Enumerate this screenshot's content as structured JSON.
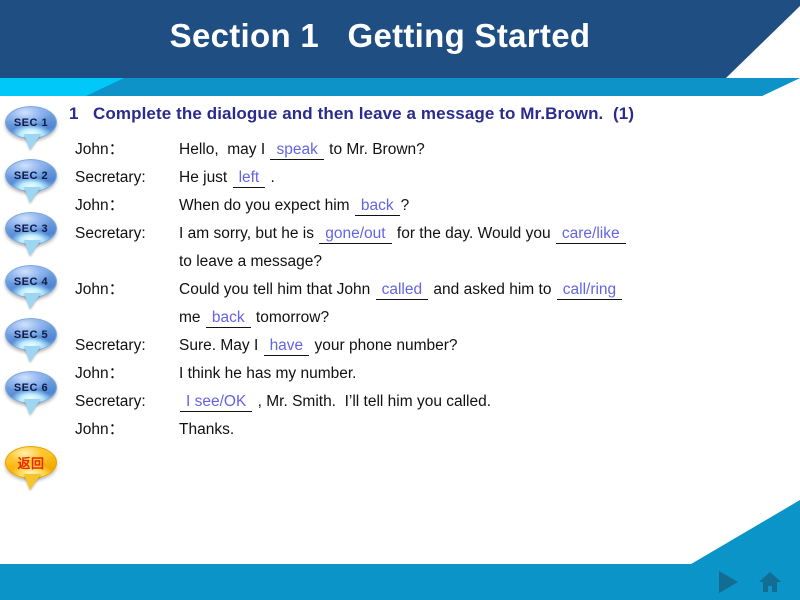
{
  "header": {
    "title": "Section 1   Getting Started",
    "band_color": "#1F4E83",
    "stripe_cyan": "#00C9FA",
    "stripe_blue": "#0D93C7"
  },
  "sidebar": {
    "items": [
      {
        "label": "SEC 1",
        "icon": "speech-bubble-icon"
      },
      {
        "label": "SEC 2",
        "icon": "speech-bubble-icon"
      },
      {
        "label": "SEC 3",
        "icon": "speech-bubble-icon"
      },
      {
        "label": "SEC 4",
        "icon": "speech-bubble-icon"
      },
      {
        "label": "SEC 5",
        "icon": "speech-bubble-icon"
      },
      {
        "label": "SEC 6",
        "icon": "speech-bubble-icon"
      }
    ],
    "back_button": {
      "label": "返回",
      "icon": "speech-bubble-icon",
      "color": "#F9BB18",
      "text_color": "#E8290B"
    }
  },
  "main": {
    "exercise_title": "1   Complete the dialogue and then leave a message to Mr.Brown.  (1)",
    "title_color": "#2B2B8F",
    "blank_color": "#6464E6",
    "dialogue": [
      {
        "speaker": "John：",
        "parts": [
          {
            "type": "text",
            "value": "Hello,  may I "
          },
          {
            "type": "blank",
            "value": "speak"
          },
          {
            "type": "text",
            "value": " to Mr. Brown?"
          }
        ]
      },
      {
        "speaker": "Secretary:",
        "parts": [
          {
            "type": "text",
            "value": "He just "
          },
          {
            "type": "blank",
            "value": "left"
          },
          {
            "type": "text",
            "value": " ."
          }
        ]
      },
      {
        "speaker": "John：",
        "parts": [
          {
            "type": "text",
            "value": "When do you expect him "
          },
          {
            "type": "blank",
            "value": "back"
          },
          {
            "type": "text",
            "value": "?"
          }
        ]
      },
      {
        "speaker": "Secretary:",
        "parts": [
          {
            "type": "text",
            "value": "I am sorry, but he is "
          },
          {
            "type": "blank",
            "value": "gone/out"
          },
          {
            "type": "text",
            "value": " for the day. Would you "
          },
          {
            "type": "blank",
            "value": "care/like"
          }
        ]
      },
      {
        "speaker": "",
        "parts": [
          {
            "type": "text",
            "value": "to leave a message?"
          }
        ]
      },
      {
        "speaker": "John：",
        "parts": [
          {
            "type": "text",
            "value": "Could you tell him that John "
          },
          {
            "type": "blank",
            "value": "called"
          },
          {
            "type": "text",
            "value": " and asked him to "
          },
          {
            "type": "blank",
            "value": "call/ring"
          }
        ]
      },
      {
        "speaker": "",
        "parts": [
          {
            "type": "text",
            "value": "me "
          },
          {
            "type": "blank",
            "value": "back"
          },
          {
            "type": "text",
            "value": " tomorrow?"
          }
        ]
      },
      {
        "speaker": "Secretary:",
        "parts": [
          {
            "type": "text",
            "value": "Sure. May I "
          },
          {
            "type": "blank",
            "value": "have"
          },
          {
            "type": "text",
            "value": " your phone number?"
          }
        ]
      },
      {
        "speaker": "John：",
        "parts": [
          {
            "type": "text",
            "value": "I think he has my number."
          }
        ]
      },
      {
        "speaker": "Secretary:",
        "parts": [
          {
            "type": "blank",
            "value": "I see/OK"
          },
          {
            "type": "text",
            "value": " , Mr. Smith.  I’ll tell him you called."
          }
        ]
      },
      {
        "speaker": "John：",
        "parts": [
          {
            "type": "text",
            "value": "Thanks."
          }
        ]
      }
    ]
  },
  "footer": {
    "band_color": "#0A94C8",
    "icons": [
      {
        "name": "play-next-icon"
      },
      {
        "name": "home-icon"
      }
    ]
  }
}
